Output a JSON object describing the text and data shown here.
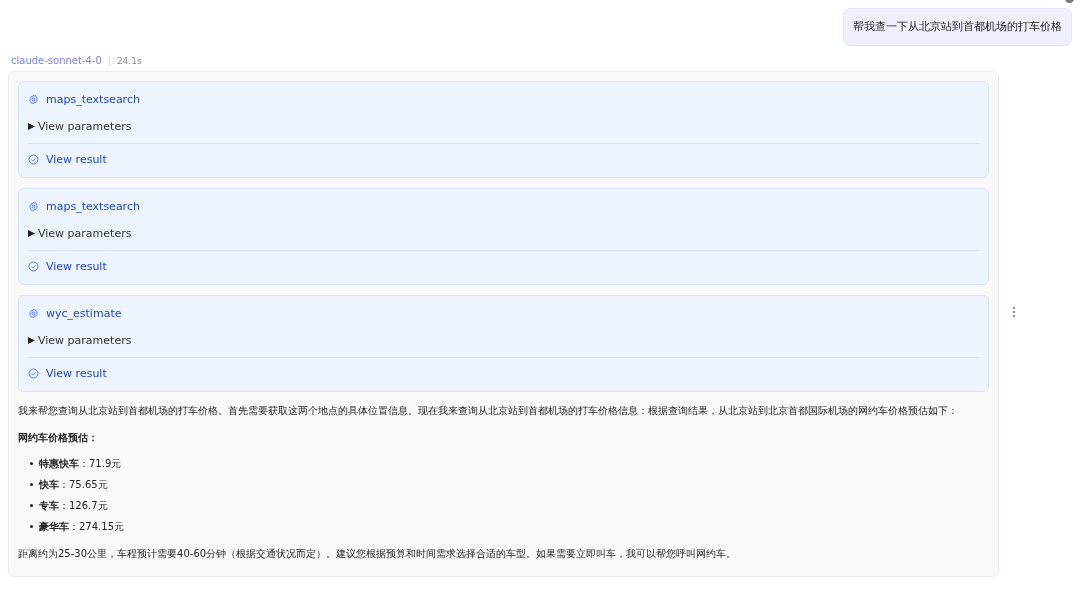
{
  "user_message": "帮我查一下从北京站到首都机场的打车价格",
  "response": {
    "model": "claude-sonnet-4-0",
    "elapsed": "24.1s",
    "tool_calls": [
      {
        "name": "maps_textsearch",
        "parameters_label": "View parameters",
        "expanded": false,
        "result_label": "View result"
      },
      {
        "name": "maps_textsearch",
        "parameters_label": "View parameters",
        "expanded": false,
        "result_label": "View result"
      },
      {
        "name": "wyc_estimate",
        "parameters_label": "View parameters",
        "expanded": false,
        "result_label": "View result"
      }
    ],
    "intro": "我来帮您查询从北京站到首都机场的打车价格。首先需要获取这两个地点的具体位置信息。现在我来查询从北京站到首都机场的打车价格信息：根据查询结果，从北京站到北京首都国际机场的网约车价格预估如下：",
    "heading": "网约车价格预估：",
    "prices": [
      "**特惠快车**：71.9元",
      "**快车**：75.65元",
      "**专车**：126.7元",
      "**豪华车**：274.15元"
    ],
    "closing": "距离约为25-30公里，车程预计需要40-60分钟（根据交通状况而定）。建议您根据预算和时间需求选择合适的车型。如果需要立即叫车，我可以帮您呼叫网约车。"
  }
}
